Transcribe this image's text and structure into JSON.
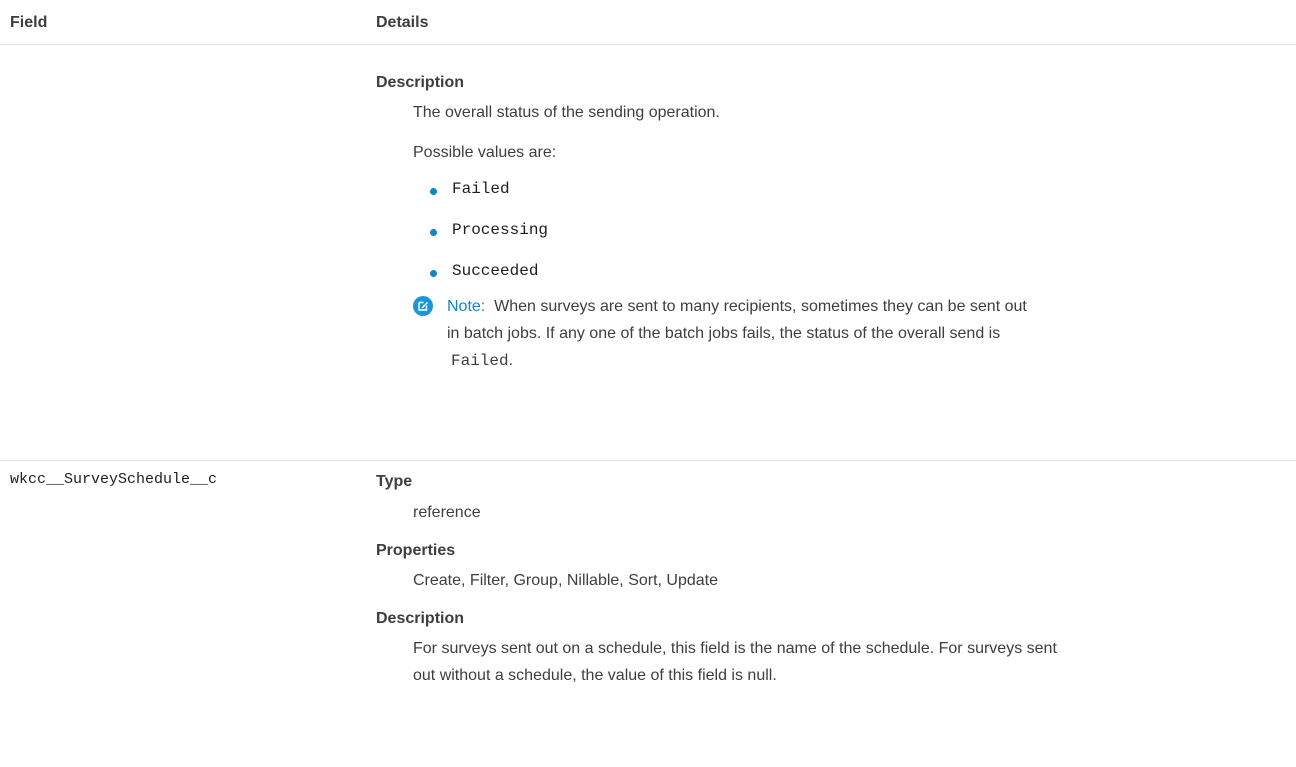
{
  "header": {
    "field": "Field",
    "details": "Details"
  },
  "rows": [
    {
      "description": {
        "term": "Description",
        "text": "The overall status of the sending operation.",
        "possible_values_intro": "Possible values are:",
        "values": [
          "Failed",
          "Processing",
          "Succeeded"
        ],
        "note": {
          "icon": "note-edit-icon",
          "label": "Note:",
          "line1": "When surveys are sent to many recipients, sometimes they can be sent out",
          "line2": "in batch jobs. If any one of the batch jobs fails, the status of the overall send is",
          "line3_code": "Failed",
          "line3_suffix": "."
        }
      }
    },
    {
      "field_name": "wkcc__SurveySchedule__c",
      "type": {
        "term": "Type",
        "value": "reference"
      },
      "properties": {
        "term": "Properties",
        "value": "Create, Filter, Group, Nillable, Sort, Update"
      },
      "description": {
        "term": "Description",
        "line1": "For surveys sent out on a schedule, this field is the name of the schedule. For surveys sent",
        "line2": "out without a schedule, the value of this field is null."
      }
    }
  ],
  "colors": {
    "accent": "#0e87c9",
    "note_icon": "#1b96d6",
    "divider": "#d8dde6",
    "text": "#3e3e3c"
  }
}
